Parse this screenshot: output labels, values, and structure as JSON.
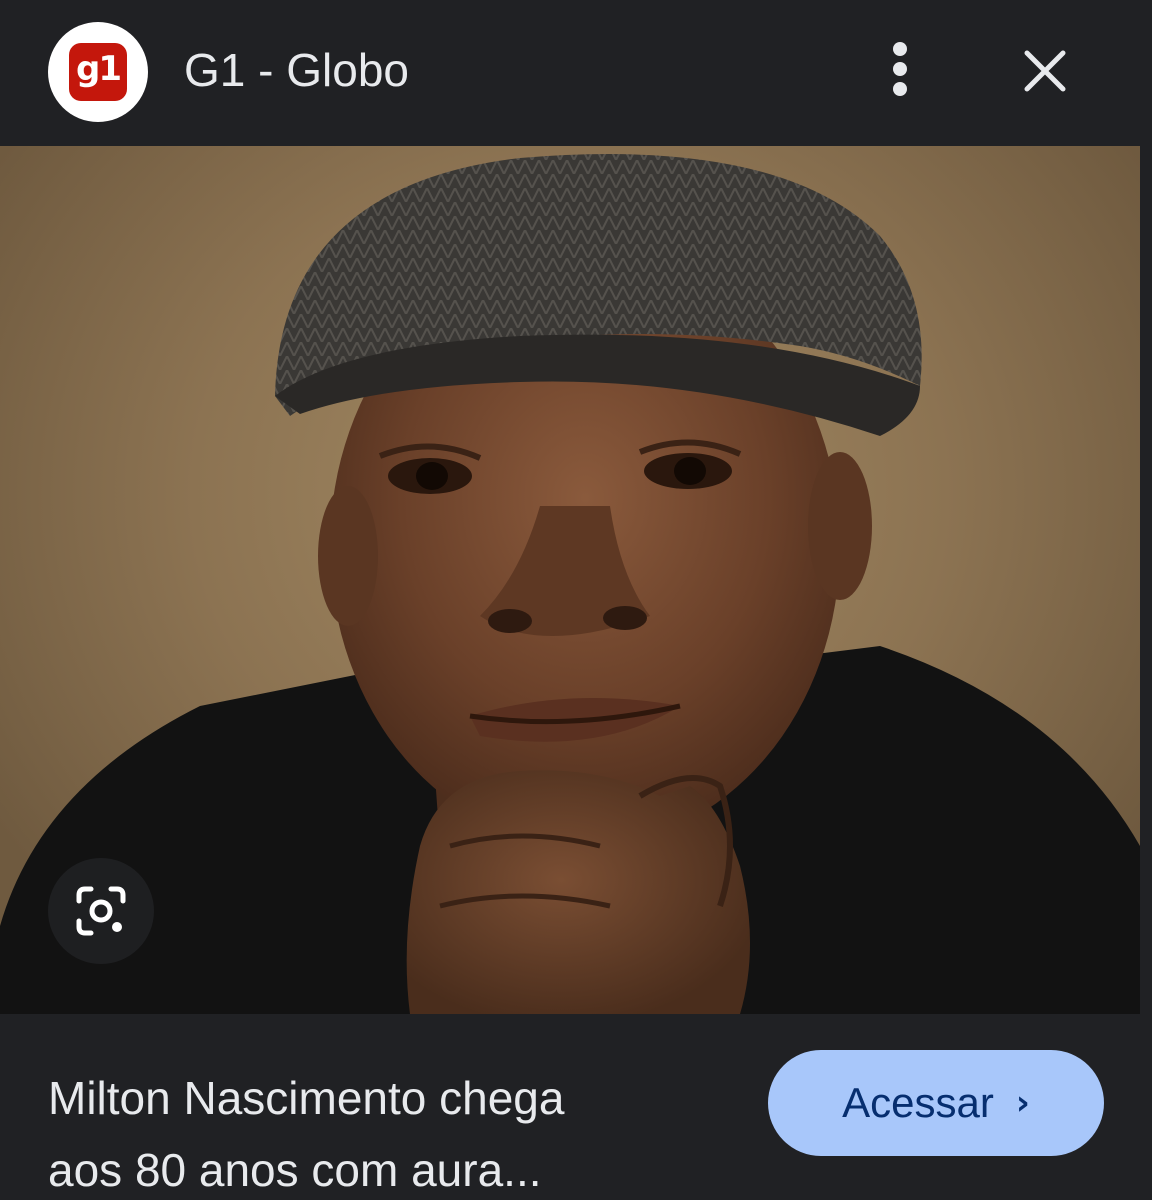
{
  "header": {
    "logo_text": "g1",
    "site_name": "G1 - Globo",
    "more_icon": "more-vert-icon",
    "close_icon": "close-icon"
  },
  "image": {
    "lens_icon": "google-lens-icon"
  },
  "footer": {
    "headline_line1": "Milton Nascimento chega",
    "headline_line2": "aos 80 anos com aura...",
    "visit_label": "Acessar",
    "visit_chevron": "›"
  },
  "colors": {
    "background": "#202124",
    "brand": "#c4170c",
    "button": "#a8c7fa",
    "button_text": "#062e6f",
    "text": "#e8eaed"
  }
}
